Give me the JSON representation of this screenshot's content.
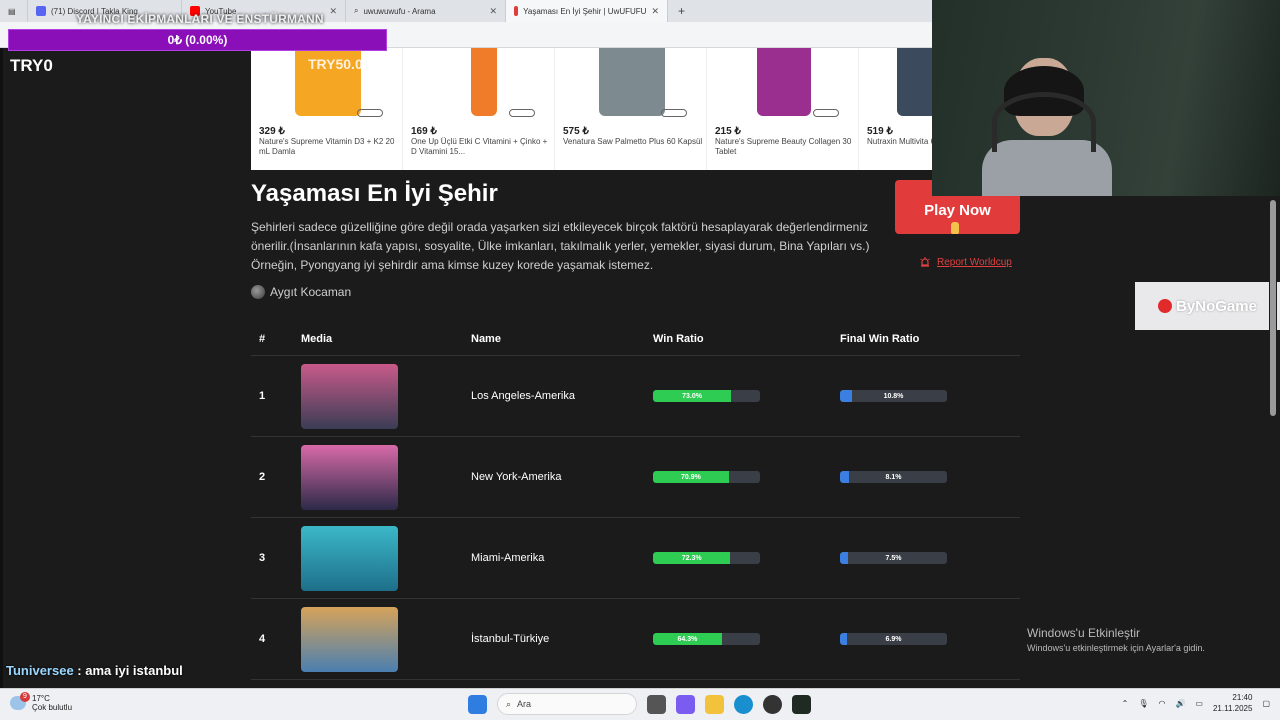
{
  "browser": {
    "tabs": [
      {
        "label": "(71) Discord | Takla King",
        "color": "#5865f2"
      },
      {
        "label": "YouTube",
        "color": "#ff0000"
      },
      {
        "label": "uwuwuwufu - Arama",
        "color": "#555555"
      },
      {
        "label": "Yaşaması En İyi Şehir | UwUFUFU",
        "color": "#e23b3b"
      }
    ],
    "new_tab": "+"
  },
  "overlay": {
    "donation_title": "YAYINCI EKİPMANLARI VE ENSTÜRMANN",
    "donation_progress": "0₺ (0.00%)",
    "donation_fraction": 0.0,
    "goal_counter": "TRY0",
    "brand_overlay": "TRY50.00",
    "chat": {
      "user": "Tuniversee",
      "message": " : ama iyi istanbul"
    }
  },
  "products": [
    {
      "price": "329 ₺",
      "name": "Nature's Supreme Vitamin D3 + K2 20 mL Damla",
      "color": "#f5a623"
    },
    {
      "price": "169 ₺",
      "name": "One Up Üçlü Etki C Vitamini + Çinko + D Vitamini 15...",
      "color": "#f07c2a"
    },
    {
      "price": "575 ₺",
      "name": "Venatura Saw Palmetto Plus 60 Kapsül",
      "color": "#7d8a8f"
    },
    {
      "price": "215 ₺",
      "name": "Nature's Supreme Beauty Collagen 30 Tablet",
      "color": "#9b2f8f"
    },
    {
      "price": "519 ₺",
      "name": "Nutraxin Multivita 60 Tablet",
      "color": "#3b4a5c"
    }
  ],
  "page": {
    "title": "Yaşaması En İyi Şehir",
    "description": "Şehirleri sadece güzelliğine göre değil orada yaşarken sizi etkileyecek birçok faktörü hesaplayarak değerlendirmeniz önerilir.(İnsanlarının kafa yapısı, sosyalite, Ülke imkanları, takılmalık yerler, yemekler, siyasi durum, Bina Yapıları vs.) Örneğin, Pyongyang iyi şehirdir ama kimse kuzey korede yaşamak istemez.",
    "author": "Aygıt Kocaman",
    "play_button": "Play Now",
    "report_link": "Report Worldcup",
    "sponsor": "ByNoGame"
  },
  "table": {
    "headers": {
      "idx": "#",
      "media": "Media",
      "name": "Name",
      "win": "Win Ratio",
      "final": "Final Win Ratio"
    },
    "rows": [
      {
        "idx": "1",
        "name": "Los Angeles-Amerika",
        "win_label": "73.0%",
        "win": 0.73,
        "final_label": "10.8%",
        "final": 0.108,
        "thumb": [
          "#c85a8a",
          "#3a3d55"
        ]
      },
      {
        "idx": "2",
        "name": "New York-Amerika",
        "win_label": "70.9%",
        "win": 0.709,
        "final_label": "8.1%",
        "final": 0.081,
        "thumb": [
          "#d86aa8",
          "#2c2a48"
        ]
      },
      {
        "idx": "3",
        "name": "Miami-Amerika",
        "win_label": "72.3%",
        "win": 0.723,
        "final_label": "7.5%",
        "final": 0.075,
        "thumb": [
          "#3bb8c8",
          "#1e6f8a"
        ]
      },
      {
        "idx": "4",
        "name": "İstanbul-Türkiye",
        "win_label": "64.3%",
        "win": 0.643,
        "final_label": "6.9%",
        "final": 0.069,
        "thumb": [
          "#d6a35a",
          "#4a7fb0"
        ]
      }
    ]
  },
  "activation": {
    "title": "Windows'u Etkinleştir",
    "subtitle": "Windows'u etkinleştirmek için Ayarlar'a gidin."
  },
  "taskbar": {
    "weather_temp": "17°C",
    "weather_desc": "Çok bulutlu",
    "notif_count": "9",
    "search_placeholder": "Ara",
    "time": "21:40",
    "date": "21.11.2025"
  }
}
